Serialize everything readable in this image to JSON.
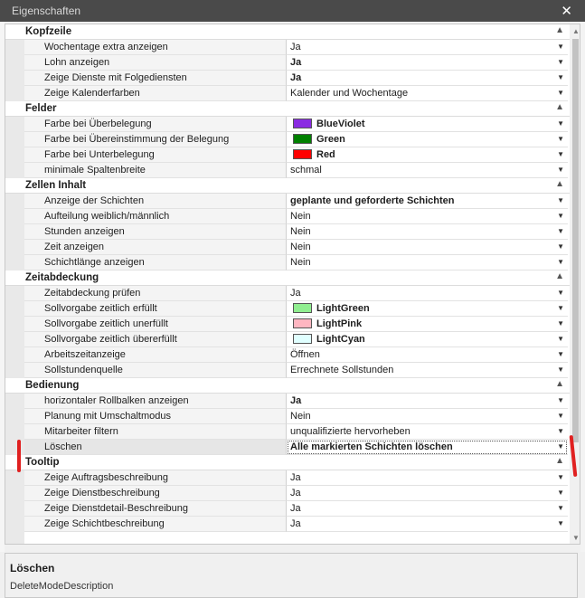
{
  "window": {
    "title": "Eigenschaften",
    "close_glyph": "✕"
  },
  "glyphs": {
    "collapse": "▲",
    "dropdown": "▼",
    "scroll_up": "▲",
    "scroll_down": "▼"
  },
  "background_hints": {
    "left_glyph": "",
    "right_glyph": ""
  },
  "categories": [
    {
      "label": "Kopfzeile",
      "props": [
        {
          "name": "Wochentage extra anzeigen",
          "value": "Ja",
          "bold": false
        },
        {
          "name": "Lohn anzeigen",
          "value": "Ja",
          "bold": true
        },
        {
          "name": "Zeige Dienste mit Folgediensten",
          "value": "Ja",
          "bold": true
        },
        {
          "name": "Zeige Kalenderfarben",
          "value": "Kalender und Wochentage",
          "bold": false
        }
      ]
    },
    {
      "label": "Felder",
      "props": [
        {
          "name": "Farbe bei Überbelegung",
          "value": "BlueViolet",
          "bold": true,
          "swatch": "#8a2be2"
        },
        {
          "name": "Farbe bei Übereinstimmung der Belegung",
          "value": "Green",
          "bold": true,
          "swatch": "#008000"
        },
        {
          "name": "Farbe bei Unterbelegung",
          "value": "Red",
          "bold": true,
          "swatch": "#ff0000"
        },
        {
          "name": "minimale Spaltenbreite",
          "value": "schmal",
          "bold": false
        }
      ]
    },
    {
      "label": "Zellen Inhalt",
      "props": [
        {
          "name": "Anzeige der Schichten",
          "value": "geplante und geforderte Schichten",
          "bold": true
        },
        {
          "name": "Aufteilung weiblich/männlich",
          "value": "Nein",
          "bold": false
        },
        {
          "name": "Stunden anzeigen",
          "value": "Nein",
          "bold": false
        },
        {
          "name": "Zeit anzeigen",
          "value": "Nein",
          "bold": false
        },
        {
          "name": "Schichtlänge anzeigen",
          "value": "Nein",
          "bold": false
        }
      ]
    },
    {
      "label": "Zeitabdeckung",
      "props": [
        {
          "name": "Zeitabdeckung prüfen",
          "value": "Ja",
          "bold": false
        },
        {
          "name": "Sollvorgabe zeitlich erfüllt",
          "value": "LightGreen",
          "bold": true,
          "swatch": "#90ee90"
        },
        {
          "name": "Sollvorgabe zeitlich unerfüllt",
          "value": "LightPink",
          "bold": true,
          "swatch": "#ffb6c1"
        },
        {
          "name": "Sollvorgabe zeitlich übererfüllt",
          "value": "LightCyan",
          "bold": true,
          "swatch": "#e0ffff"
        },
        {
          "name": "Arbeitszeitanzeige",
          "value": "Öffnen",
          "bold": false
        },
        {
          "name": "Sollstundenquelle",
          "value": "Errechnete Sollstunden",
          "bold": false
        }
      ]
    },
    {
      "label": "Bedienung",
      "props": [
        {
          "name": "horizontaler Rollbalken anzeigen",
          "value": "Ja",
          "bold": true
        },
        {
          "name": "Planung mit Umschaltmodus",
          "value": "Nein",
          "bold": false
        },
        {
          "name": "Mitarbeiter filtern",
          "value": "unqualifizierte hervorheben",
          "bold": false
        },
        {
          "name": "Löschen",
          "value": "Alle markierten Schichten löschen",
          "bold": true,
          "selected": true
        }
      ]
    },
    {
      "label": "Tooltip",
      "props": [
        {
          "name": "Zeige Auftragsbeschreibung",
          "value": "Ja",
          "bold": false
        },
        {
          "name": "Zeige Dienstbeschreibung",
          "value": "Ja",
          "bold": false
        },
        {
          "name": "Zeige Dienstdetail-Beschreibung",
          "value": "Ja",
          "bold": false
        },
        {
          "name": "Zeige Schichtbeschreibung",
          "value": "Ja",
          "bold": false
        }
      ]
    }
  ],
  "description": {
    "title": "Löschen",
    "text": "DeleteModeDescription"
  },
  "colors": {
    "annotation": "#e02020",
    "titlebar": "#4a4a4a"
  }
}
